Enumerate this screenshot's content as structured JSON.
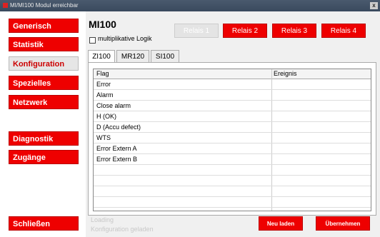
{
  "window": {
    "title": "MI/MI100 Modul erreichbar",
    "close_glyph": "x"
  },
  "sidebar": {
    "items": [
      {
        "label": "Generisch"
      },
      {
        "label": "Statistik"
      },
      {
        "label": "Konfiguration"
      },
      {
        "label": "Spezielles"
      },
      {
        "label": "Netzwerk"
      },
      {
        "label": "Diagnostik"
      },
      {
        "label": "Zugänge"
      }
    ],
    "close_label": "Schließen"
  },
  "main": {
    "device_title": "MI100",
    "multiplicative_logic_label": "multiplikative Logik",
    "multiplicative_logic_checked": false,
    "relays": [
      {
        "label": "Relais 1",
        "enabled": false
      },
      {
        "label": "Relais 2",
        "enabled": true
      },
      {
        "label": "Relais 3",
        "enabled": true
      },
      {
        "label": "Relais 4",
        "enabled": true
      }
    ],
    "tabs": [
      {
        "label": "ZI100",
        "active": true
      },
      {
        "label": "MR120",
        "active": false
      },
      {
        "label": "SI100",
        "active": false
      }
    ],
    "table": {
      "columns": [
        "Flag",
        "Ereignis"
      ],
      "rows": [
        [
          "Error",
          ""
        ],
        [
          "Alarm",
          ""
        ],
        [
          "Close alarm",
          ""
        ],
        [
          "H (OK)",
          ""
        ],
        [
          "D (Accu defect)",
          ""
        ],
        [
          "WTS",
          ""
        ],
        [
          "Error Extern A",
          ""
        ],
        [
          "Error Extern B",
          ""
        ],
        [
          "",
          ""
        ],
        [
          "",
          ""
        ],
        [
          "",
          ""
        ],
        [
          "",
          ""
        ]
      ]
    },
    "status_lines": [
      "Loading",
      "Konfiguration geladen"
    ],
    "buttons": {
      "reload": "Neu laden",
      "apply": "Übernehmen"
    }
  },
  "colors": {
    "accent_red": "#ee0000",
    "disabled_gray": "#e4e4e4"
  }
}
